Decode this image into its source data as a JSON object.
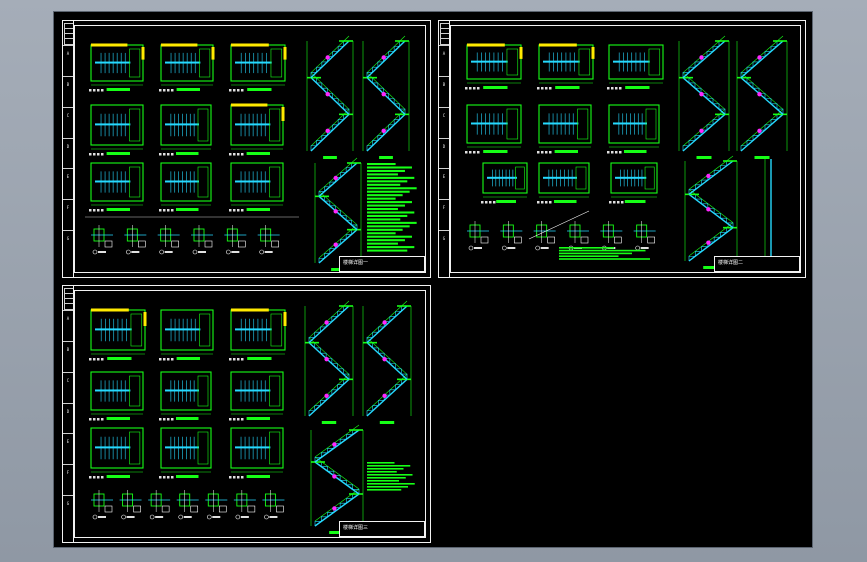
{
  "app": {
    "view_background_color": "#000000",
    "window_background_color": "#98a1ad",
    "line_colors": {
      "plan": "#16ff16",
      "section": "#25d9ff",
      "highlight": "#ffea00",
      "detail_mark": "#ff27ff",
      "frame": "#f2f2f2"
    }
  },
  "sheets": [
    {
      "name": "sheet-top-left",
      "title": "楼梯详图一",
      "zone_marks": [
        "A",
        "B",
        "C",
        "D",
        "E",
        "F",
        "G"
      ]
    },
    {
      "name": "sheet-top-right",
      "title": "楼梯详图二",
      "zone_marks": [
        "A",
        "B",
        "C",
        "D",
        "E",
        "F",
        "G"
      ]
    },
    {
      "name": "sheet-bottom-left",
      "title": "楼梯详图三",
      "zone_marks": [
        "A",
        "B",
        "C",
        "D",
        "E",
        "F",
        "G"
      ]
    }
  ]
}
